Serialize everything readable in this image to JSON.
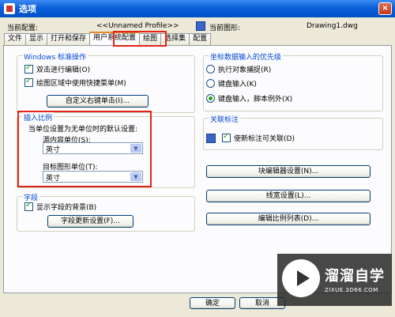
{
  "window": {
    "title": "选项",
    "close": "×"
  },
  "info": {
    "current_profile_label": "当前配置:",
    "current_profile": "<<Unnamed Profile>>",
    "current_drawing_label": "当前图形:",
    "current_drawing": "Drawing1.dwg"
  },
  "tabs": [
    "文件",
    "显示",
    "打开和保存",
    "用户系统配置",
    "绘图",
    "选择集",
    "配置"
  ],
  "windows_ops": {
    "title": "Windows 标准操作",
    "dblclick_edit": "双击进行编辑(O)",
    "shortcut_menu": "绘图区域中使用快捷菜单(M)",
    "custom_right_click": "自定义右键单击(I)..."
  },
  "insert_scale": {
    "title": "插入比例",
    "desc": "当单位设置为无单位时的默认设置:",
    "source_label": "源内容单位(S):",
    "source_value": "英寸",
    "target_label": "目标图形单位(T):",
    "target_value": "英寸"
  },
  "fields": {
    "title": "字段",
    "show_background": "显示字段的背景(B)",
    "update_settings": "字段更新设置(F)..."
  },
  "coord_priority": {
    "title": "坐标数据输入的优先级",
    "osnap": "执行对象捕捉(R)",
    "keyboard": "键盘输入(K)",
    "keyboard_except_scripts": "键盘输入，脚本例外(X)"
  },
  "associative_dim": {
    "title": "关联标注",
    "make_associative": "使新标注可关联(D)"
  },
  "buttons": {
    "block_editor": "块编辑器设置(N)...",
    "lineweight": "线宽设置(L)...",
    "edit_scale_list": "编辑比例列表(D)...",
    "ok": "确定",
    "cancel": "取消"
  },
  "watermark": {
    "text": "溜溜自学",
    "sub": "ZIXUE.3D66.COM"
  }
}
